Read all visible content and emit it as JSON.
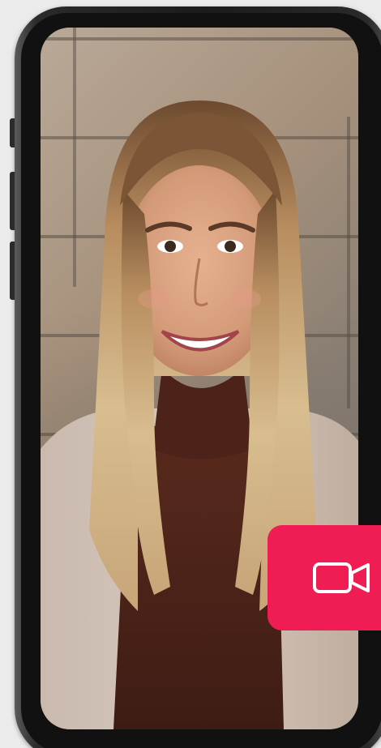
{
  "screen": {
    "content": "selfie-video-preview"
  },
  "video_button": {
    "icon": "video-camera-icon",
    "color": "#ef1d53"
  },
  "phone": {
    "frame_color": "#1b1b1b"
  }
}
